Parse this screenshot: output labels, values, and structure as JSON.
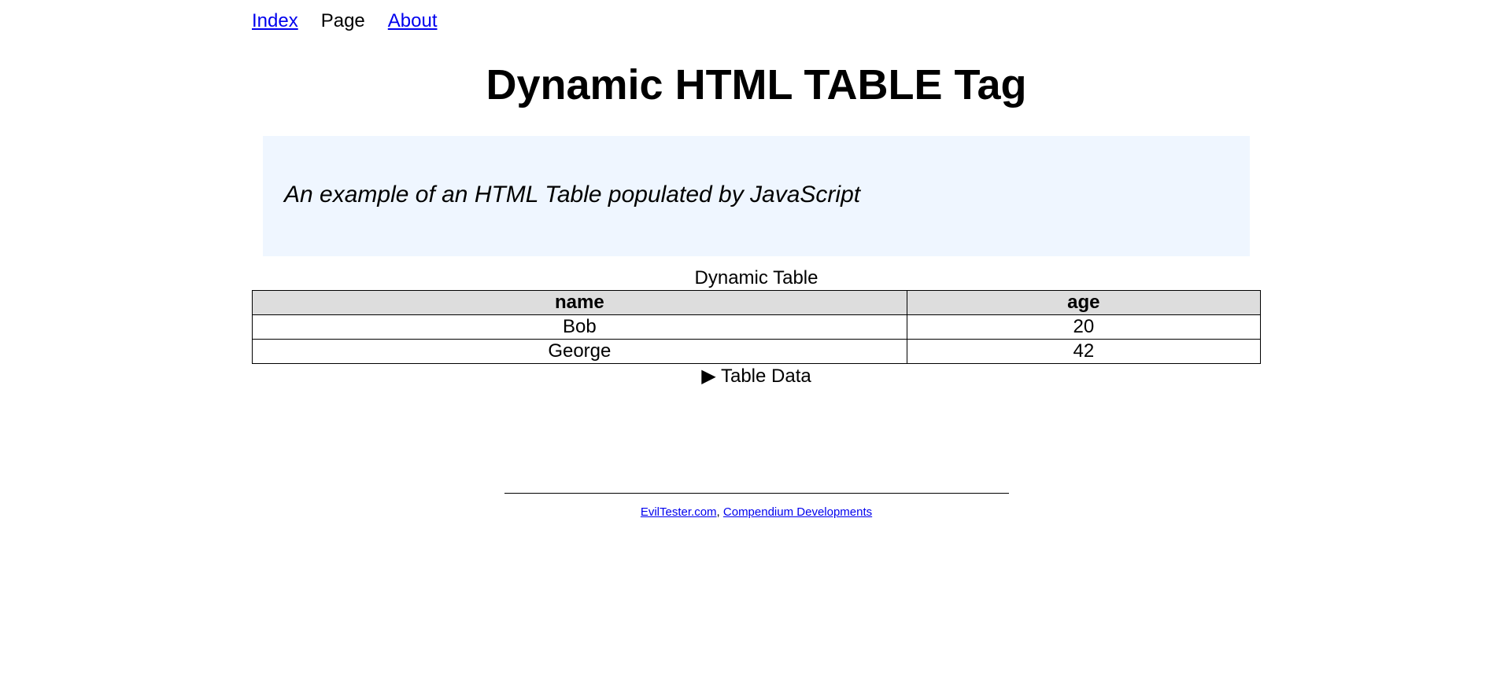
{
  "nav": {
    "items": [
      {
        "label": "Index",
        "link": true
      },
      {
        "label": "Page",
        "link": false
      },
      {
        "label": "About",
        "link": true
      }
    ]
  },
  "title": "Dynamic HTML TABLE Tag",
  "intro": {
    "text": "An example of an HTML Table populated by JavaScript"
  },
  "table": {
    "caption": "Dynamic Table",
    "columns": [
      "name",
      "age"
    ],
    "rows": [
      [
        "Bob",
        "20"
      ],
      [
        "George",
        "42"
      ]
    ]
  },
  "details": {
    "marker": "▶",
    "summary": "Table Data"
  },
  "footer": {
    "link1": "EvilTester.com",
    "separator": ",",
    "link2": "Compendium Developments"
  }
}
